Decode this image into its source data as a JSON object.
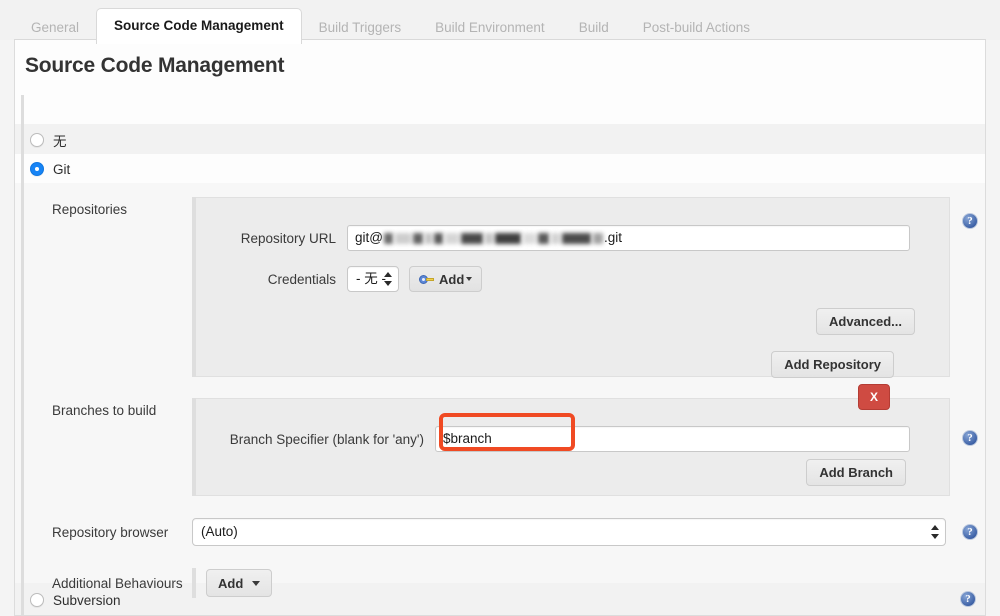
{
  "tabs": [
    {
      "label": "General",
      "active": false
    },
    {
      "label": "Source Code Management",
      "active": true
    },
    {
      "label": "Build Triggers",
      "active": false
    },
    {
      "label": "Build Environment",
      "active": false
    },
    {
      "label": "Build",
      "active": false
    },
    {
      "label": "Post-build Actions",
      "active": false
    }
  ],
  "page": {
    "title": "Source Code Management"
  },
  "scm_options": {
    "none_label": "无",
    "git_label": "Git",
    "subversion_label": "Subversion",
    "selected": "Git"
  },
  "repositories": {
    "section_label": "Repositories",
    "url_label": "Repository URL",
    "url_prefix": "git@",
    "url_suffix": ".git",
    "url_redacted": true,
    "credentials_label": "Credentials",
    "credentials_value": "- 无 -",
    "credentials_add_label": "Add",
    "credentials_add_icon": "key-icon",
    "advanced_label": "Advanced...",
    "add_repository_label": "Add Repository"
  },
  "branches": {
    "section_label": "Branches to build",
    "specifier_label": "Branch Specifier (blank for 'any')",
    "specifier_value": "$branch",
    "add_branch_label": "Add Branch",
    "delete_label": "X",
    "highlight_color": "#f04a23"
  },
  "repository_browser": {
    "label": "Repository browser",
    "value": "(Auto)"
  },
  "additional_behaviours": {
    "label": "Additional Behaviours",
    "add_label": "Add"
  },
  "icons": {
    "help": "?"
  },
  "colors": {
    "accent_blue": "#1784f5",
    "help_blue": "#3f63a8",
    "danger_red": "#cf4b42",
    "annotation_orange": "#f04a23",
    "panel_gray": "#ececec"
  }
}
